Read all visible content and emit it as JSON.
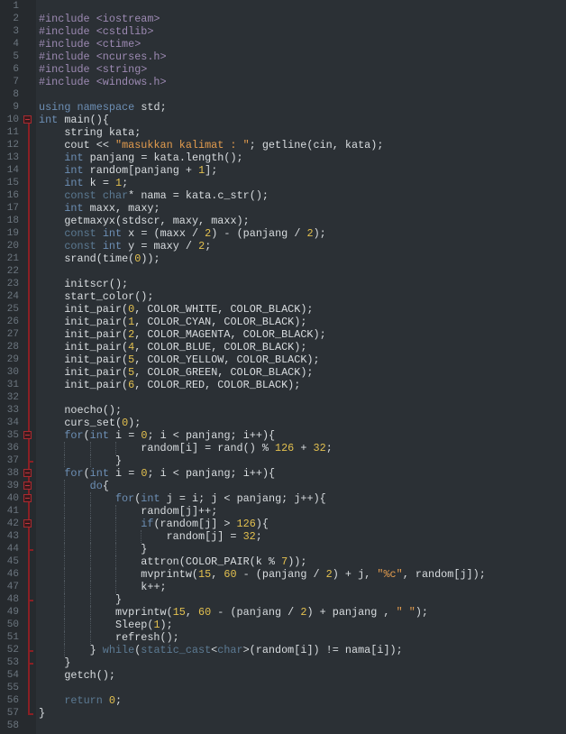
{
  "editor": {
    "language": "cpp",
    "colors": {
      "background": "#2b3035",
      "gutter": "#262a2e",
      "fold_marker": "#a82a30"
    },
    "fold_start_lines": [
      10,
      35,
      38,
      39,
      40,
      42
    ],
    "fold_end_lines": [
      37,
      44,
      48,
      52,
      53,
      57
    ],
    "lines": [
      "",
      "#include <iostream>",
      "#include <cstdlib>",
      "#include <ctime>",
      "#include <ncurses.h>",
      "#include <string>",
      "#include <windows.h>",
      "",
      "using namespace std;",
      "int main(){",
      "    string kata;",
      "    cout << \"masukkan kalimat : \"; getline(cin, kata);",
      "    int panjang = kata.length();",
      "    int random[panjang + 1];",
      "    int k = 1;",
      "    const char* nama = kata.c_str();",
      "    int maxx, maxy;",
      "    getmaxyx(stdscr, maxy, maxx);",
      "    const int x = (maxx / 2) - (panjang / 2);",
      "    const int y = maxy / 2;",
      "    srand(time(0));",
      "",
      "    initscr();",
      "    start_color();",
      "    init_pair(0, COLOR_WHITE, COLOR_BLACK);",
      "    init_pair(1, COLOR_CYAN, COLOR_BLACK);",
      "    init_pair(2, COLOR_MAGENTA, COLOR_BLACK);",
      "    init_pair(4, COLOR_BLUE, COLOR_BLACK);",
      "    init_pair(5, COLOR_YELLOW, COLOR_BLACK);",
      "    init_pair(5, COLOR_GREEN, COLOR_BLACK);",
      "    init_pair(6, COLOR_RED, COLOR_BLACK);",
      "",
      "    noecho();",
      "    curs_set(0);",
      "    for(int i = 0; i < panjang; i++){",
      "                random[i] = rand() % 126 + 32;",
      "            }",
      "    for(int i = 0; i < panjang; i++){",
      "        do{",
      "            for(int j = i; j < panjang; j++){",
      "                random[j]++;",
      "                if(random[j] > 126){",
      "                    random[j] = 32;",
      "                }",
      "                attron(COLOR_PAIR(k % 7));",
      "                mvprintw(15, 60 - (panjang / 2) + j, \"%c\", random[j]);",
      "                k++;",
      "            }",
      "            mvprintw(15, 60 - (panjang / 2) + panjang , \" \");",
      "            Sleep(1);",
      "            refresh();",
      "        } while(static_cast<char>(random[i]) != nama[i]);",
      "    }",
      "    getch();",
      "",
      "    return 0;",
      "}",
      ""
    ]
  }
}
